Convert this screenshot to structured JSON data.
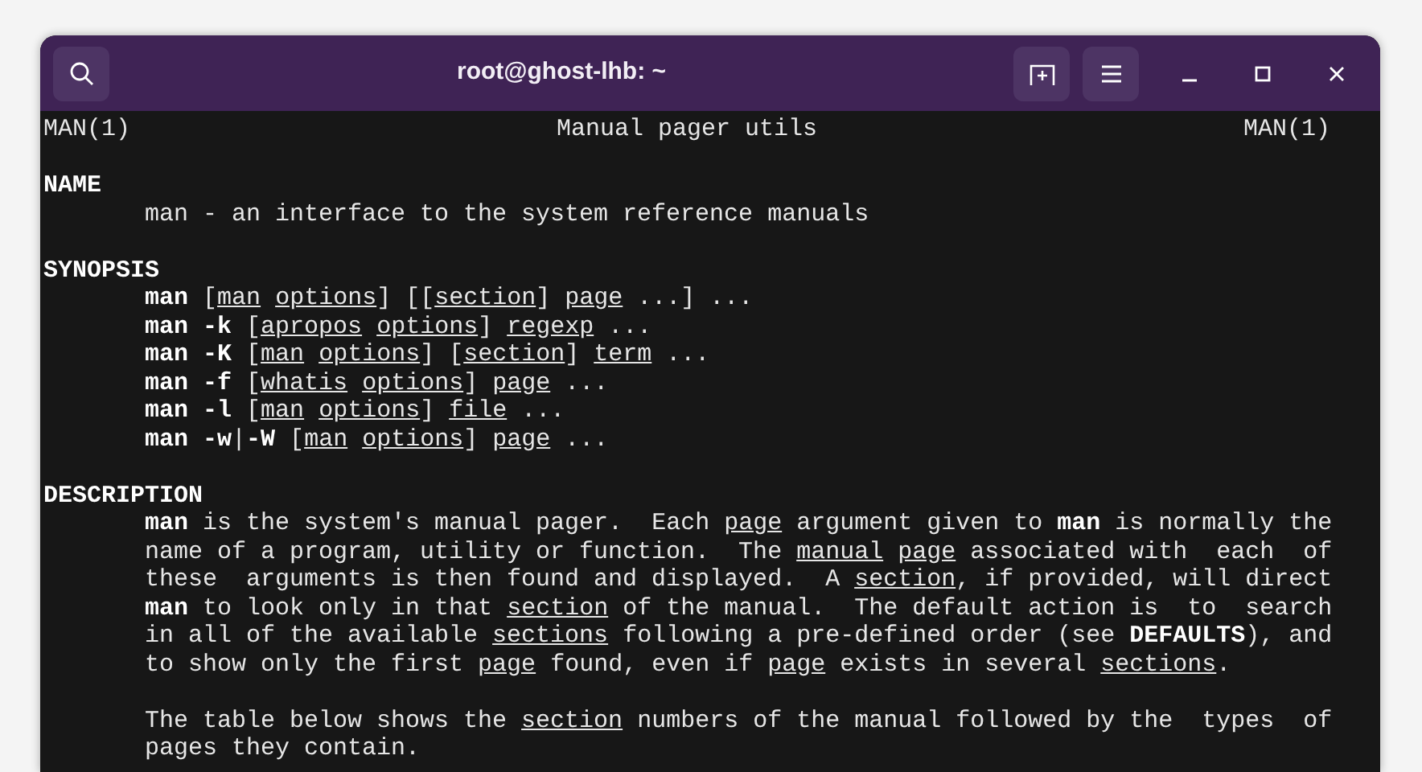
{
  "window": {
    "title": "root@ghost-lhb: ~"
  },
  "header": {
    "left": "MAN(1)",
    "center": "Manual pager utils",
    "right": "MAN(1)"
  },
  "sections": [
    {
      "heading": "NAME",
      "paragraphs": [
        {
          "lines": [
            [
              {
                "text": "man - an interface to the system reference manuals",
                "kind": "plain"
              }
            ]
          ]
        }
      ]
    },
    {
      "heading": "SYNOPSIS",
      "paragraphs": [
        {
          "lines": [
            [
              {
                "text": "man",
                "kind": "bold"
              },
              {
                "text": " [",
                "kind": "plain"
              },
              {
                "text": "man options",
                "kind": "underline"
              },
              {
                "text": "] [[",
                "kind": "plain"
              },
              {
                "text": "section",
                "kind": "underline"
              },
              {
                "text": "] ",
                "kind": "plain"
              },
              {
                "text": "page",
                "kind": "underline"
              },
              {
                "text": " ...] ...",
                "kind": "plain"
              }
            ],
            [
              {
                "text": "man -k",
                "kind": "bold"
              },
              {
                "text": " [",
                "kind": "plain"
              },
              {
                "text": "apropos options",
                "kind": "underline"
              },
              {
                "text": "] ",
                "kind": "plain"
              },
              {
                "text": "regexp",
                "kind": "underline"
              },
              {
                "text": " ...",
                "kind": "plain"
              }
            ],
            [
              {
                "text": "man -K",
                "kind": "bold"
              },
              {
                "text": " [",
                "kind": "plain"
              },
              {
                "text": "man options",
                "kind": "underline"
              },
              {
                "text": "] [",
                "kind": "plain"
              },
              {
                "text": "section",
                "kind": "underline"
              },
              {
                "text": "] ",
                "kind": "plain"
              },
              {
                "text": "term",
                "kind": "underline"
              },
              {
                "text": " ...",
                "kind": "plain"
              }
            ],
            [
              {
                "text": "man -f",
                "kind": "bold"
              },
              {
                "text": " [",
                "kind": "plain"
              },
              {
                "text": "whatis options",
                "kind": "underline"
              },
              {
                "text": "] ",
                "kind": "plain"
              },
              {
                "text": "page",
                "kind": "underline"
              },
              {
                "text": " ...",
                "kind": "plain"
              }
            ],
            [
              {
                "text": "man -l",
                "kind": "bold"
              },
              {
                "text": " [",
                "kind": "plain"
              },
              {
                "text": "man options",
                "kind": "underline"
              },
              {
                "text": "] ",
                "kind": "plain"
              },
              {
                "text": "file",
                "kind": "underline"
              },
              {
                "text": " ...",
                "kind": "plain"
              }
            ],
            [
              {
                "text": "man -w",
                "kind": "bold"
              },
              {
                "text": "|",
                "kind": "plain"
              },
              {
                "text": "-W",
                "kind": "bold"
              },
              {
                "text": " [",
                "kind": "plain"
              },
              {
                "text": "man options",
                "kind": "underline"
              },
              {
                "text": "] ",
                "kind": "plain"
              },
              {
                "text": "page",
                "kind": "underline"
              },
              {
                "text": " ...",
                "kind": "plain"
              }
            ]
          ]
        }
      ]
    },
    {
      "heading": "DESCRIPTION",
      "paragraphs": [
        {
          "lines": [
            [
              {
                "text": "man",
                "kind": "bold"
              },
              {
                "text": " is the system's manual pager.  Each ",
                "kind": "plain"
              },
              {
                "text": "page",
                "kind": "underline"
              },
              {
                "text": " argument given to ",
                "kind": "plain"
              },
              {
                "text": "man",
                "kind": "bold"
              },
              {
                "text": " is normally the",
                "kind": "plain"
              }
            ],
            [
              {
                "text": "name of a program, utility or function.  The ",
                "kind": "plain"
              },
              {
                "text": "manual page",
                "kind": "underline"
              },
              {
                "text": " associated with  each  of",
                "kind": "plain"
              }
            ],
            [
              {
                "text": "these  arguments is then found and displayed.  A ",
                "kind": "plain"
              },
              {
                "text": "section",
                "kind": "underline"
              },
              {
                "text": ", if provided, will direct",
                "kind": "plain"
              }
            ],
            [
              {
                "text": "man",
                "kind": "bold"
              },
              {
                "text": " to look only in that ",
                "kind": "plain"
              },
              {
                "text": "section",
                "kind": "underline"
              },
              {
                "text": " of the manual.  The default action is  to  search",
                "kind": "plain"
              }
            ],
            [
              {
                "text": "in all of the available ",
                "kind": "plain"
              },
              {
                "text": "sections",
                "kind": "underline"
              },
              {
                "text": " following a pre-defined order (see ",
                "kind": "plain"
              },
              {
                "text": "DEFAULTS",
                "kind": "bold"
              },
              {
                "text": "), and",
                "kind": "plain"
              }
            ],
            [
              {
                "text": "to show only the first ",
                "kind": "plain"
              },
              {
                "text": "page",
                "kind": "underline"
              },
              {
                "text": " found, even if ",
                "kind": "plain"
              },
              {
                "text": "page",
                "kind": "underline"
              },
              {
                "text": " exists in several ",
                "kind": "plain"
              },
              {
                "text": "sections",
                "kind": "underline"
              },
              {
                "text": ".",
                "kind": "plain"
              }
            ]
          ]
        },
        {
          "lines": [
            [
              {
                "text": "The table below shows the ",
                "kind": "plain"
              },
              {
                "text": "section",
                "kind": "underline"
              },
              {
                "text": " numbers of the manual followed by the  types  of",
                "kind": "plain"
              }
            ],
            [
              {
                "text": "pages they contain.",
                "kind": "plain"
              }
            ]
          ]
        }
      ]
    }
  ]
}
